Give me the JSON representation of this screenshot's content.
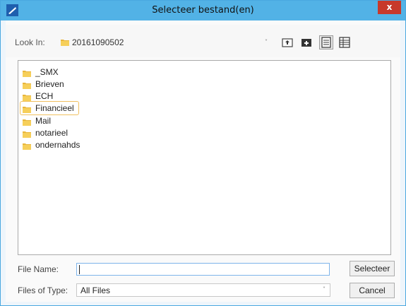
{
  "window": {
    "title": "Selecteer bestand(en)",
    "close_glyph": "x"
  },
  "look_in": {
    "label": "Look In:",
    "value": "20161090502",
    "dropdown_glyph": "˅"
  },
  "toolbar": {
    "up_icon": "up-folder-icon",
    "new_folder_icon": "new-folder-icon",
    "list_icon": "list-view-icon",
    "details_icon": "details-view-icon"
  },
  "files": {
    "items": [
      {
        "label": "_SMX"
      },
      {
        "label": "Brieven"
      },
      {
        "label": "ECH"
      },
      {
        "label": "Financieel",
        "selected": true
      },
      {
        "label": "Mail"
      },
      {
        "label": "notarieel"
      },
      {
        "label": "ondernahds"
      }
    ]
  },
  "file_name": {
    "label": "File Name:",
    "value": ""
  },
  "file_type": {
    "label": "Files of Type:",
    "value": "All Files",
    "dropdown_glyph": "˅"
  },
  "buttons": {
    "select": "Selecteer",
    "cancel": "Cancel"
  },
  "colors": {
    "titlebar": "#52b2e6",
    "close": "#c7392b",
    "folder": "#e8b63c",
    "selection_border": "#f0c060"
  }
}
